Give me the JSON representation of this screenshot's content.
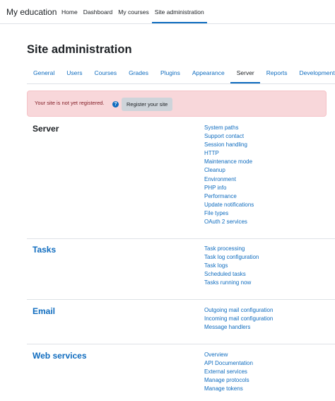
{
  "navbar": {
    "brand": "My education",
    "items": [
      {
        "label": "Home",
        "active": false
      },
      {
        "label": "Dashboard",
        "active": false
      },
      {
        "label": "My courses",
        "active": false
      },
      {
        "label": "Site administration",
        "active": true
      }
    ]
  },
  "page": {
    "title": "Site administration"
  },
  "tabs": [
    {
      "label": "General",
      "active": false
    },
    {
      "label": "Users",
      "active": false
    },
    {
      "label": "Courses",
      "active": false
    },
    {
      "label": "Grades",
      "active": false
    },
    {
      "label": "Plugins",
      "active": false
    },
    {
      "label": "Appearance",
      "active": false
    },
    {
      "label": "Server",
      "active": true
    },
    {
      "label": "Reports",
      "active": false
    },
    {
      "label": "Development",
      "active": false
    }
  ],
  "alert": {
    "message": "Your site is not yet registered.",
    "help_icon": "?",
    "button_label": "Register your site"
  },
  "sections": {
    "server": {
      "title": "Server",
      "links": [
        "System paths",
        "Support contact",
        "Session handling",
        "HTTP",
        "Maintenance mode",
        "Cleanup",
        "Environment",
        "PHP info",
        "Performance",
        "Update notifications",
        "File types",
        "OAuth 2 services"
      ]
    },
    "tasks": {
      "title": "Tasks",
      "links": [
        "Task processing",
        "Task log configuration",
        "Task logs",
        "Scheduled tasks",
        "Tasks running now"
      ]
    },
    "email": {
      "title": "Email",
      "links": [
        "Outgoing mail configuration",
        "Incoming mail configuration",
        "Message handlers"
      ]
    },
    "web_services": {
      "title": "Web services",
      "links": [
        "Overview",
        "API Documentation",
        "External services",
        "Manage protocols",
        "Manage tokens"
      ]
    }
  },
  "colors": {
    "link": "#0f6cbf",
    "alert_bg": "#f8d7da",
    "alert_text": "#842029",
    "button_bg": "#ced4da"
  }
}
